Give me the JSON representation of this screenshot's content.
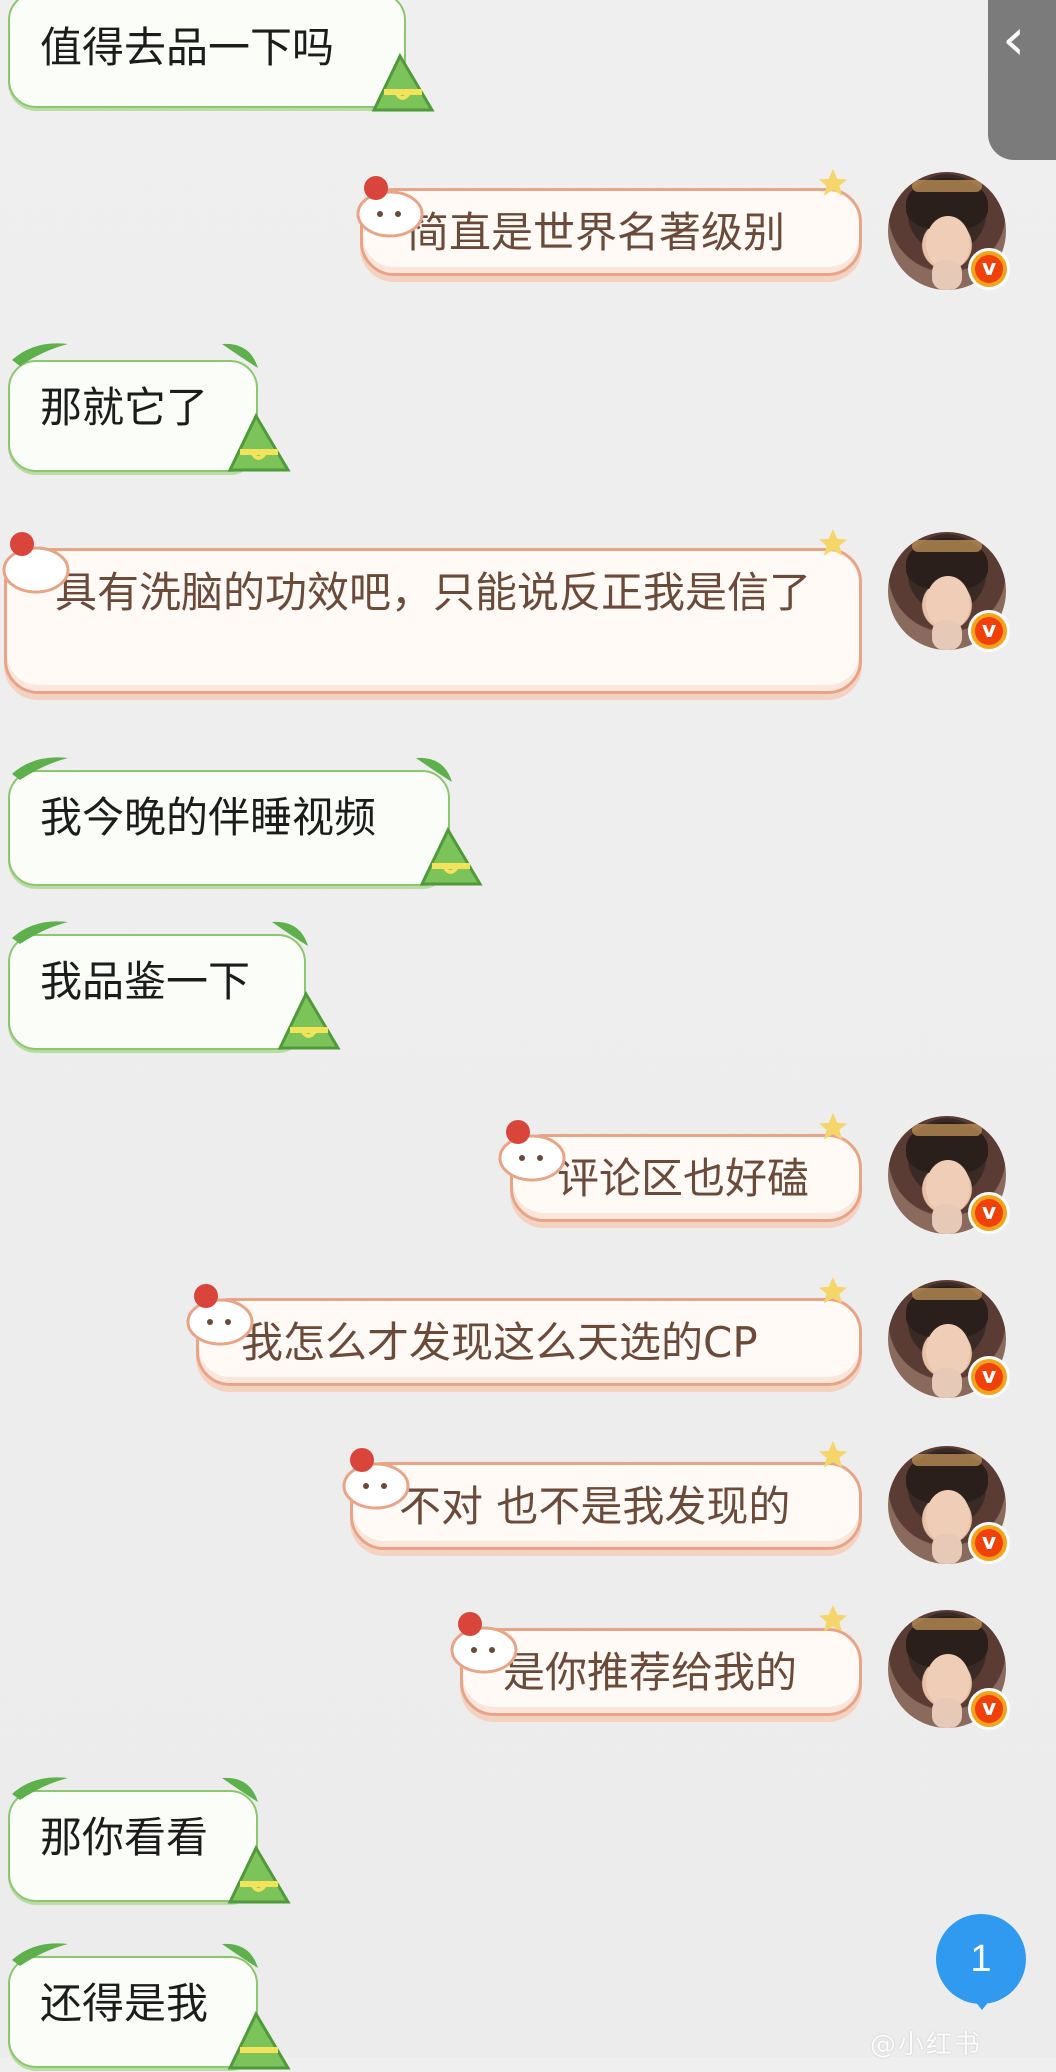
{
  "messages": [
    {
      "side": "left",
      "text": "值得去品一下吗"
    },
    {
      "side": "right",
      "text": "简直是世界名著级别"
    },
    {
      "side": "left",
      "text": "那就它了"
    },
    {
      "side": "right",
      "text": "具有洗脑的功效吧，只能说反正我是信了"
    },
    {
      "side": "left",
      "text": "我今晚的伴睡视频"
    },
    {
      "side": "left",
      "text": "我品鉴一下"
    },
    {
      "side": "right",
      "text": "评论区也好磕"
    },
    {
      "side": "right",
      "text": "我怎么才发现这么天选的CP"
    },
    {
      "side": "right",
      "text": "不对 也不是我发现的"
    },
    {
      "side": "right",
      "text": "是你推荐给我的"
    },
    {
      "side": "left",
      "text": "那你看看"
    },
    {
      "side": "left",
      "text": "还得是我"
    }
  ],
  "vip_badge": "v",
  "unread_count": "1",
  "watermark": "@小红书",
  "icons": {
    "back": "chevron-left-icon",
    "leaf": "bamboo-leaf-icon",
    "zongzi": "zongzi-icon",
    "cat": "cat-icon",
    "star": "star-icon"
  },
  "colors": {
    "left_border": "#8cc66e",
    "right_border": "#e9a488",
    "unread": "#2f9af0",
    "vip": "#f0410b"
  }
}
